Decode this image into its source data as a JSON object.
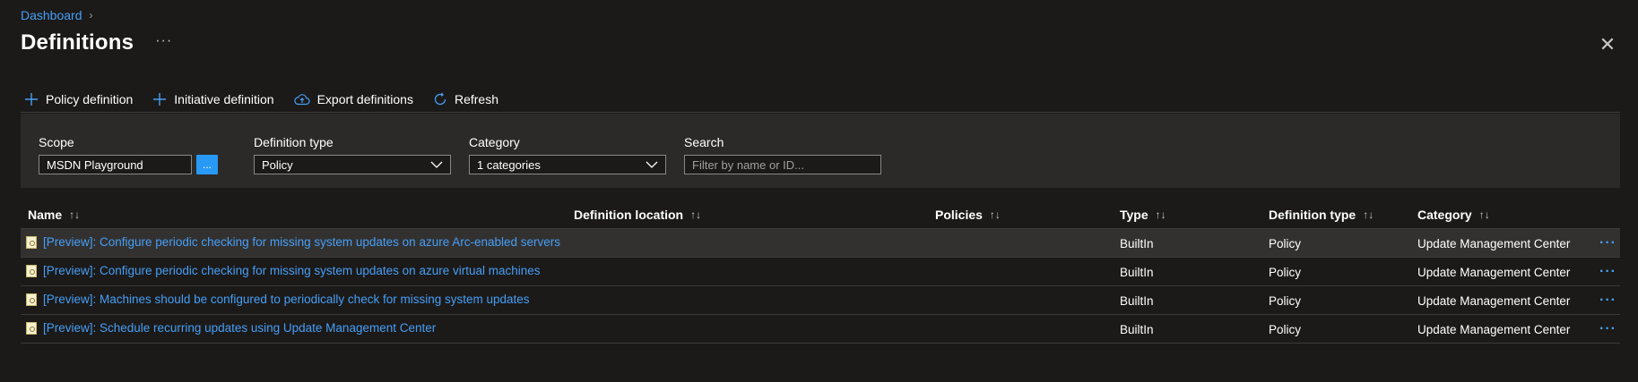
{
  "breadcrumb": {
    "items": [
      "Dashboard"
    ]
  },
  "page": {
    "title": "Definitions",
    "more": "···",
    "close": "✕"
  },
  "toolbar": {
    "policy_definition": "Policy definition",
    "initiative_definition": "Initiative definition",
    "export_definitions": "Export definitions",
    "refresh": "Refresh"
  },
  "filters": {
    "scope": {
      "label": "Scope",
      "value": "MSDN Playground",
      "button": "..."
    },
    "definition_type": {
      "label": "Definition type",
      "value": "Policy"
    },
    "category": {
      "label": "Category",
      "value": "1 categories"
    },
    "search": {
      "label": "Search",
      "placeholder": "Filter by name or ID..."
    }
  },
  "table": {
    "columns": [
      "Name",
      "Definition location",
      "Policies",
      "Type",
      "Definition type",
      "Category"
    ],
    "sort_icon": "↑↓",
    "rows": [
      {
        "name": "[Preview]: Configure periodic checking for missing system updates on azure Arc-enabled servers",
        "location": "",
        "policies": "",
        "type": "BuiltIn",
        "definition_type": "Policy",
        "category": "Update Management Center"
      },
      {
        "name": "[Preview]: Configure periodic checking for missing system updates on azure virtual machines",
        "location": "",
        "policies": "",
        "type": "BuiltIn",
        "definition_type": "Policy",
        "category": "Update Management Center"
      },
      {
        "name": "[Preview]: Machines should be configured to periodically check for missing system updates",
        "location": "",
        "policies": "",
        "type": "BuiltIn",
        "definition_type": "Policy",
        "category": "Update Management Center"
      },
      {
        "name": "[Preview]: Schedule recurring updates using Update Management Center",
        "location": "",
        "policies": "",
        "type": "BuiltIn",
        "definition_type": "Policy",
        "category": "Update Management Center"
      }
    ],
    "row_more": "···"
  },
  "colors": {
    "accent": "#479ef5",
    "background": "#1b1a19",
    "filter_bg": "#2b2a29",
    "row_hover": "#323130"
  },
  "icons": [
    "chevron-right-icon",
    "more-icon",
    "close-icon",
    "add-icon",
    "cloud-upload-icon",
    "refresh-icon",
    "chevron-down-icon",
    "sort-icon",
    "policy-icon"
  ]
}
